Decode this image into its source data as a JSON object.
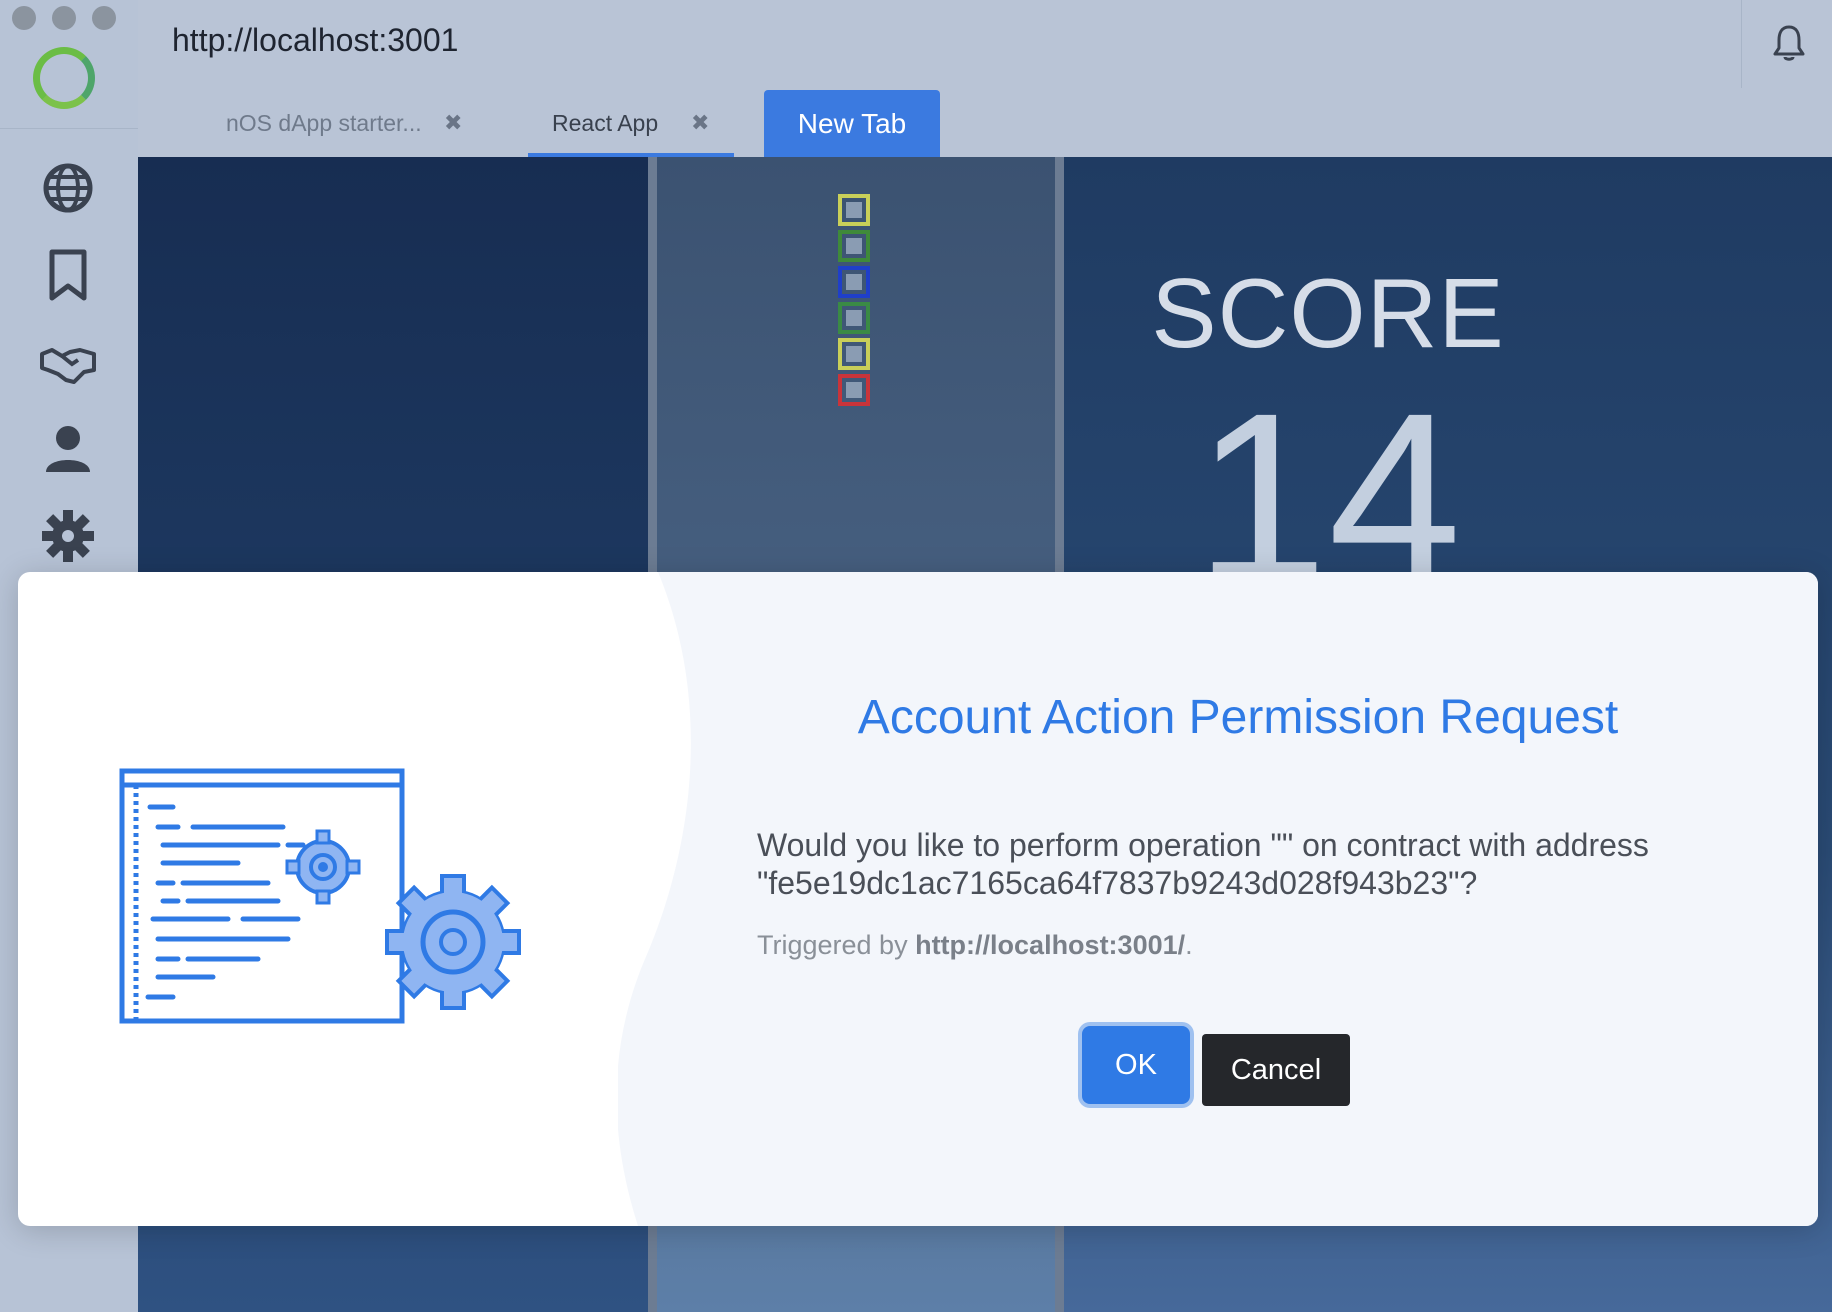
{
  "window": {
    "url": "http://localhost:3001"
  },
  "tabs": [
    {
      "label": "nOS dApp starter...",
      "closable": true,
      "active": false
    },
    {
      "label": "React App",
      "closable": true,
      "active": true
    },
    {
      "label": "New Tab",
      "closable": false,
      "active": false
    }
  ],
  "sidebar": {
    "icons": [
      "globe-icon",
      "bookmark-icon",
      "handshake-icon",
      "user-icon",
      "gear-icon"
    ]
  },
  "game": {
    "score_label": "SCORE",
    "score_value": "14",
    "block_colors": [
      "#c9cf59",
      "#3f8a3a",
      "#1f3fc9",
      "#3a8a45",
      "#c9cf59",
      "#c9343a"
    ]
  },
  "modal": {
    "title": "Account Action Permission Request",
    "message": "Would you like to perform operation \"\" on contract with address \"fe5e19dc1ac7165ca64f7837b9243d028f943b23\"?",
    "trigger_prefix": "Triggered by ",
    "trigger_url": "http://localhost:3001/",
    "trigger_suffix": ".",
    "ok_label": "OK",
    "cancel_label": "Cancel"
  },
  "colors": {
    "accent": "#2f7ae5",
    "dark_button": "#25272b"
  }
}
